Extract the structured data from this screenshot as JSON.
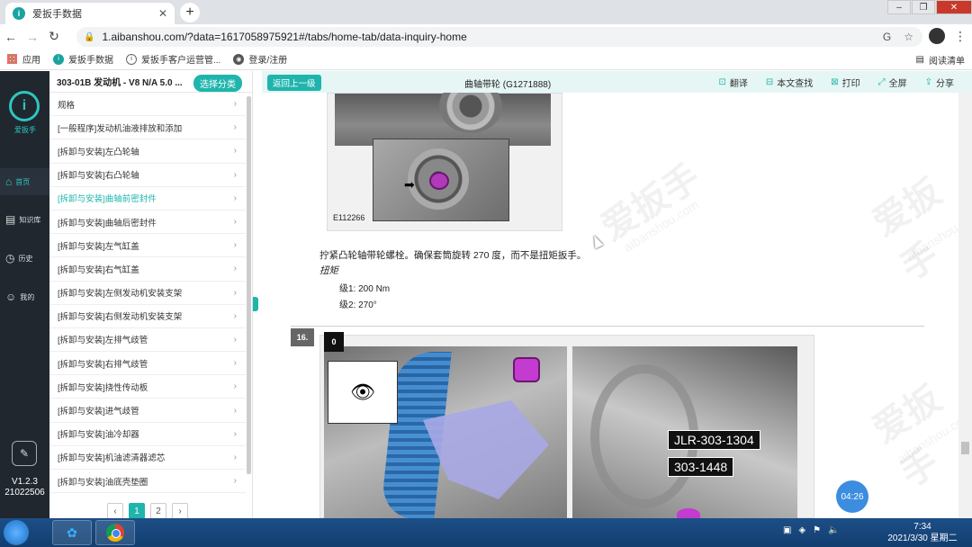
{
  "browser": {
    "tab_title": "爱扳手数据",
    "tab_favicon": "i",
    "url": "1.aibanshou.com/?data=1617058975921#/tabs/home-tab/data-inquiry-home",
    "bookmarks": [
      {
        "label": "应用"
      },
      {
        "label": "爱扳手数据"
      },
      {
        "label": "爱扳手客户运营管..."
      },
      {
        "label": "登录/注册"
      }
    ],
    "reading_list": "阅读清单"
  },
  "rail": {
    "logo_text": "i",
    "brand": "爱扳手",
    "items": [
      {
        "icon": "home-icon",
        "glyph": "⌂",
        "label": "首页",
        "active": true
      },
      {
        "icon": "book-icon",
        "glyph": "▤",
        "label": "知识库",
        "active": false
      },
      {
        "icon": "clock-icon",
        "glyph": "◷",
        "label": "历史",
        "active": false
      },
      {
        "icon": "user-icon",
        "glyph": "☺",
        "label": "我的",
        "active": false
      }
    ],
    "version": "V1.2.3",
    "build": "21022506",
    "bottom_icon": "feedback-icon"
  },
  "categories": {
    "header": "303-01B 发动机 - V8 N/A 5.0 ...",
    "select_button": "选择分类",
    "items": [
      {
        "label": "规格",
        "active": false
      },
      {
        "label": "[一般程序]发动机油液排放和添加",
        "active": false
      },
      {
        "label": "[拆卸与安装]左凸轮轴",
        "active": false
      },
      {
        "label": "[拆卸与安装]右凸轮轴",
        "active": false
      },
      {
        "label": "[拆卸与安装]曲轴前密封件",
        "active": true
      },
      {
        "label": "[拆卸与安装]曲轴后密封件",
        "active": false
      },
      {
        "label": "[拆卸与安装]左气缸盖",
        "active": false
      },
      {
        "label": "[拆卸与安装]右气缸盖",
        "active": false
      },
      {
        "label": "[拆卸与安装]左侧发动机安装支架",
        "active": false
      },
      {
        "label": "[拆卸与安装]右侧发动机安装支架",
        "active": false
      },
      {
        "label": "[拆卸与安装]左排气歧管",
        "active": false
      },
      {
        "label": "[拆卸与安装]右排气歧管",
        "active": false
      },
      {
        "label": "[拆卸与安装]挠性传动板",
        "active": false
      },
      {
        "label": "[拆卸与安装]进气歧管",
        "active": false
      },
      {
        "label": "[拆卸与安装]油冷却器",
        "active": false
      },
      {
        "label": "[拆卸与安装]机油滤清器滤芯",
        "active": false
      },
      {
        "label": "[拆卸与安装]油底壳垫圈",
        "active": false
      }
    ],
    "pages": [
      "1",
      "2"
    ],
    "current_page": "1"
  },
  "toolbar": {
    "back_label": "返回上一级",
    "doc_title": "曲轴带轮 (G1271888)",
    "tools": [
      {
        "icon": "translate-icon",
        "glyph": "⊡",
        "label": "翻译"
      },
      {
        "icon": "find-icon",
        "glyph": "⊟",
        "label": "本文查找"
      },
      {
        "icon": "print-icon",
        "glyph": "⊠",
        "label": "打印"
      },
      {
        "icon": "fullscreen-icon",
        "glyph": "⤢",
        "label": "全屏"
      },
      {
        "icon": "share-icon",
        "glyph": "⇪",
        "label": "分享"
      }
    ]
  },
  "document": {
    "figure1_id": "E112266",
    "instruction": "拧紧凸轮轴带轮螺栓。确保套筒旋转 270 度，而不是扭矩扳手。",
    "torque_label": "扭矩",
    "torque_stage1": "级1: 200 Nm",
    "torque_stage2": "级2: 270°",
    "step_number": "16.",
    "figure2_corner": "0",
    "tool_labels": [
      "JLR-303-1304",
      "303-1448"
    ],
    "watermark": "爱扳手",
    "watermark_url": "aibanshou.com"
  },
  "overlay": {
    "timer": "04:26"
  },
  "taskbar": {
    "time": "7:34",
    "date": "2021/3/30 星期二"
  }
}
